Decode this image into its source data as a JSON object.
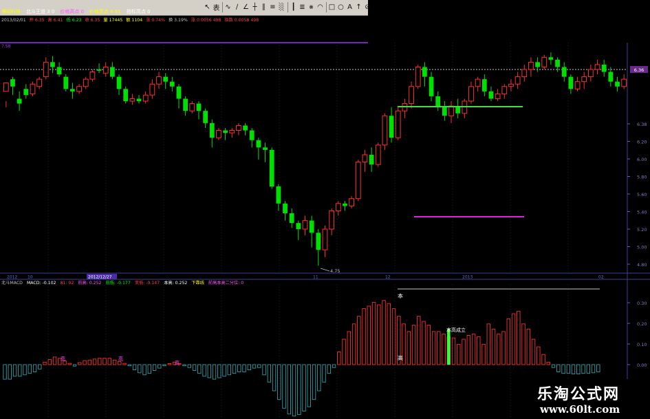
{
  "toolbar": {
    "items": [
      {
        "icon": "arrow-cursor-icon",
        "glyph": "↖"
      },
      {
        "icon": "text-tool-icon",
        "glyph": "表"
      },
      {
        "icon": "curve-tool-icon",
        "glyph": "∿"
      },
      {
        "icon": "ray-tool-icon",
        "glyph": "∕"
      },
      {
        "icon": "angle-tool-icon",
        "glyph": "∠"
      },
      {
        "icon": "cross-line-tool-icon",
        "glyph": "┼"
      },
      {
        "icon": "parallel-tool-icon",
        "glyph": "∥"
      },
      {
        "icon": "channel-tool-icon",
        "glyph": "≡"
      },
      {
        "icon": "grid-tool-icon",
        "glyph": "░"
      },
      {
        "icon": "bars-tool-icon",
        "glyph": "┃"
      },
      {
        "icon": "fibonacci-tool-icon",
        "glyph": "≣"
      },
      {
        "icon": "fan-tool-icon",
        "glyph": "⨳"
      },
      {
        "icon": "arc-tool-icon",
        "glyph": "◠"
      },
      {
        "icon": "rectangle-tool-icon",
        "glyph": "□"
      },
      {
        "icon": "circle-tool-icon",
        "glyph": "○"
      },
      {
        "icon": "label-tool-icon",
        "glyph": "A"
      },
      {
        "icon": "up-arrow-tool-icon",
        "glyph": "↑"
      },
      {
        "icon": "eraser-tool-icon",
        "glyph": "⊘"
      }
    ]
  },
  "header": {
    "line1": [
      {
        "text": "博闻科技",
        "color": "#ffff00"
      },
      {
        "text": "北斗王道 3 0",
        "color": "#ffffff"
      },
      {
        "text": "价格高点 0",
        "color": "#ff55ff"
      },
      {
        "text": "价格高点 6.61",
        "color": "#ffff00"
      },
      {
        "text": "指标高点 0",
        "color": "#ffffff"
      }
    ],
    "line2": [
      {
        "text": "2013/02/01",
        "color": "#c0c0c0"
      },
      {
        "text": "开 6.35",
        "color": "#ff4040"
      },
      {
        "text": "高 6.41",
        "color": "#ff4040"
      },
      {
        "text": "低 6.23",
        "color": "#00ff00"
      },
      {
        "text": "收 6.35",
        "color": "#ff4040"
      },
      {
        "text": "量 17445",
        "color": "#ffff00"
      },
      {
        "text": "额 1104",
        "color": "#ffff00"
      },
      {
        "text": "涨 0.74%",
        "color": "#ff4040"
      },
      {
        "text": "换 3.19%",
        "color": "#c0c0c0"
      },
      {
        "text": "涨 0.0056 498",
        "color": "#ff4040"
      },
      {
        "text": "指数 0.0058 498",
        "color": "#ff4040"
      }
    ],
    "ylabel_top": "7.58"
  },
  "price_axis": {
    "ticks": [
      "6.38",
      "6.20",
      "6.00",
      "5.80",
      "5.60",
      "5.40",
      "5.20",
      "5.00",
      "4.80"
    ],
    "current_badge": "6.36",
    "current_value": 6.36
  },
  "date_axis": {
    "labels": [
      "2012",
      "10",
      "2012/12/27",
      "11",
      "12",
      "2013",
      "02"
    ],
    "highlight": "2012/12/27"
  },
  "macd_header": [
    {
      "text": "北斗MACD",
      "color": "#c0c0c0"
    },
    {
      "text": "MACD: -0.102",
      "color": "#ffffff"
    },
    {
      "text": "81: 92",
      "color": "#ff4040"
    },
    {
      "text": "前高: 0.252",
      "color": "#ff55ff"
    },
    {
      "text": "前低: -0.177",
      "color": "#00ff00"
    },
    {
      "text": "变低: -0.147",
      "color": "#ff4040"
    },
    {
      "text": "本高: 0.252",
      "color": "#ffffff"
    },
    {
      "text": "下靠线",
      "color": "#ffff00"
    },
    {
      "text": "前高本高二分位: 0",
      "color": "#ff55ff"
    }
  ],
  "macd_axis": {
    "ticks": [
      "0.30",
      "0.20",
      "0.10",
      "0.00"
    ]
  },
  "annotations": {
    "low_price": "4.75",
    "ben": "本",
    "gao": "高",
    "bengao_chengli": "本高成立"
  },
  "chart_data": [
    {
      "type": "candlestick",
      "title": "博闻科技",
      "ylim": [
        4.7,
        6.58
      ],
      "reference_line": 6.36,
      "candles": [
        [
          6.18,
          6.25,
          6.1,
          6.05
        ],
        [
          6.28,
          6.22,
          6.3,
          6.15
        ],
        [
          6.12,
          6.08,
          6.18,
          6.02
        ],
        [
          6.2,
          6.15,
          6.24,
          6.12
        ],
        [
          6.16,
          6.24,
          6.26,
          6.14
        ],
        [
          6.22,
          6.28,
          6.3,
          6.2
        ],
        [
          6.3,
          6.42,
          6.46,
          6.28
        ],
        [
          6.42,
          6.38,
          6.47,
          6.33
        ],
        [
          6.38,
          6.32,
          6.42,
          6.3
        ],
        [
          6.3,
          6.2,
          6.32,
          6.18
        ],
        [
          6.2,
          6.18,
          6.25,
          6.12
        ],
        [
          6.18,
          6.22,
          6.24,
          6.16
        ],
        [
          6.22,
          6.28,
          6.3,
          6.2
        ],
        [
          6.28,
          6.34,
          6.36,
          6.26
        ],
        [
          6.36,
          6.35,
          6.41,
          6.33
        ],
        [
          6.33,
          6.38,
          6.42,
          6.3
        ],
        [
          6.38,
          6.3,
          6.42,
          6.28
        ],
        [
          6.3,
          6.2,
          6.32,
          6.15
        ],
        [
          6.2,
          6.1,
          6.22,
          6.08
        ],
        [
          6.1,
          6.12,
          6.16,
          6.07
        ],
        [
          6.12,
          6.1,
          6.15,
          6.08
        ],
        [
          6.1,
          6.15,
          6.18,
          6.08
        ],
        [
          6.15,
          6.24,
          6.28,
          6.12
        ],
        [
          6.24,
          6.3,
          6.34,
          6.2
        ],
        [
          6.3,
          6.26,
          6.33,
          6.2
        ],
        [
          6.26,
          6.22,
          6.3,
          6.18
        ],
        [
          6.22,
          6.12,
          6.24,
          6.04
        ],
        [
          6.12,
          6.02,
          6.14,
          5.98
        ],
        [
          6.02,
          6.08,
          6.1,
          6.0
        ],
        [
          6.08,
          6.02,
          6.1,
          5.95
        ],
        [
          6.02,
          5.92,
          6.04,
          5.88
        ],
        [
          5.92,
          5.8,
          5.95,
          5.72
        ],
        [
          5.8,
          5.86,
          5.88,
          5.78
        ],
        [
          5.86,
          5.84,
          5.88,
          5.78
        ],
        [
          5.84,
          5.86,
          5.88,
          5.8
        ],
        [
          5.86,
          5.9,
          5.92,
          5.82
        ],
        [
          5.9,
          5.86,
          5.92,
          5.82
        ],
        [
          5.86,
          5.78,
          5.88,
          5.72
        ],
        [
          5.78,
          5.72,
          5.8,
          5.62
        ],
        [
          5.72,
          5.7,
          5.76,
          5.6
        ],
        [
          5.7,
          5.4,
          5.72,
          5.38
        ],
        [
          5.4,
          5.26,
          5.42,
          5.2
        ],
        [
          5.26,
          5.18,
          5.28,
          5.12
        ],
        [
          5.18,
          5.1,
          5.22,
          5.06
        ],
        [
          5.1,
          5.05,
          5.12,
          4.96
        ],
        [
          5.05,
          5.12,
          5.16,
          5.0
        ],
        [
          5.12,
          5.02,
          5.16,
          4.9
        ],
        [
          5.02,
          4.88,
          5.05,
          4.75
        ],
        [
          4.88,
          5.05,
          5.08,
          4.82
        ],
        [
          5.05,
          5.2,
          5.22,
          5.0
        ],
        [
          5.2,
          5.26,
          5.28,
          5.16
        ],
        [
          5.26,
          5.24,
          5.28,
          5.2
        ],
        [
          5.24,
          5.3,
          5.32,
          5.22
        ],
        [
          5.3,
          5.6,
          5.62,
          5.28
        ],
        [
          5.6,
          5.66,
          5.7,
          5.52
        ],
        [
          5.66,
          5.58,
          5.72,
          5.52
        ],
        [
          5.58,
          5.74,
          5.76,
          5.56
        ],
        [
          5.74,
          5.98,
          6.0,
          5.7
        ],
        [
          5.98,
          5.8,
          6.05,
          5.76
        ],
        [
          5.8,
          6.02,
          6.06,
          5.78
        ],
        [
          6.02,
          6.08,
          6.12,
          5.96
        ],
        [
          6.08,
          6.22,
          6.26,
          6.04
        ],
        [
          6.22,
          6.38,
          6.4,
          6.2
        ],
        [
          6.38,
          6.3,
          6.42,
          6.22
        ],
        [
          6.3,
          6.14,
          6.34,
          6.1
        ],
        [
          6.14,
          6.06,
          6.18,
          6.02
        ],
        [
          6.06,
          5.98,
          6.1,
          5.94
        ],
        [
          5.98,
          6.06,
          6.1,
          5.92
        ],
        [
          6.06,
          6.0,
          6.12,
          5.96
        ],
        [
          6.0,
          6.1,
          6.12,
          5.96
        ],
        [
          6.1,
          6.22,
          6.26,
          6.08
        ],
        [
          6.22,
          6.28,
          6.3,
          6.18
        ],
        [
          6.28,
          6.18,
          6.32,
          6.14
        ],
        [
          6.18,
          6.12,
          6.22,
          6.1
        ],
        [
          6.12,
          6.16,
          6.2,
          6.1
        ],
        [
          6.16,
          6.22,
          6.24,
          6.12
        ],
        [
          6.22,
          6.24,
          6.28,
          6.18
        ],
        [
          6.24,
          6.3,
          6.34,
          6.2
        ],
        [
          6.3,
          6.36,
          6.4,
          6.26
        ],
        [
          6.36,
          6.42,
          6.46,
          6.3
        ],
        [
          6.42,
          6.38,
          6.46,
          6.34
        ],
        [
          6.38,
          6.46,
          6.48,
          6.36
        ],
        [
          6.46,
          6.44,
          6.5,
          6.4
        ],
        [
          6.44,
          6.38,
          6.46,
          6.34
        ],
        [
          6.38,
          6.3,
          6.42,
          6.26
        ],
        [
          6.3,
          6.2,
          6.32,
          6.16
        ],
        [
          6.2,
          6.26,
          6.3,
          6.18
        ],
        [
          6.26,
          6.3,
          6.34,
          6.2
        ],
        [
          6.3,
          6.36,
          6.4,
          6.26
        ],
        [
          6.36,
          6.4,
          6.44,
          6.32
        ],
        [
          6.4,
          6.34,
          6.44,
          6.3
        ],
        [
          6.34,
          6.26,
          6.38,
          6.22
        ],
        [
          6.26,
          6.22,
          6.3,
          6.18
        ],
        [
          6.22,
          6.28,
          6.32,
          6.2
        ]
      ]
    },
    {
      "type": "bar",
      "title": "北斗MACD",
      "ylim": [
        -0.18,
        0.3
      ],
      "values": [
        -0.05,
        -0.05,
        -0.04,
        -0.04,
        -0.035,
        -0.03,
        -0.025,
        -0.015,
        0.01,
        0.02,
        0.03,
        0.025,
        0.015,
        0.005,
        -0.005,
        0.008,
        0.016,
        0.018,
        0.022,
        0.025,
        0.025,
        0.025,
        0.018,
        0.012,
        0.005,
        -0.004,
        -0.018,
        -0.028,
        -0.035,
        -0.03,
        -0.02,
        -0.012,
        -0.004,
        0.004,
        0.01,
        0.004,
        -0.004,
        -0.01,
        -0.02,
        -0.03,
        -0.04,
        -0.045,
        -0.05,
        -0.045,
        -0.04,
        -0.035,
        -0.03,
        -0.025,
        -0.025,
        -0.018,
        -0.012,
        -0.01,
        -0.035,
        -0.06,
        -0.09,
        -0.12,
        -0.15,
        -0.17,
        -0.177,
        -0.172,
        -0.16,
        -0.145,
        -0.12,
        -0.09,
        -0.06,
        -0.03,
        -0.01,
        0.05,
        0.1,
        0.13,
        0.16,
        0.19,
        0.22,
        0.23,
        0.245,
        0.235,
        0.252,
        0.24,
        0.22,
        0.19,
        0.16,
        0.13,
        0.155,
        0.19,
        0.17,
        0.155,
        0.13,
        0.13,
        0.12,
        0.11,
        0.105,
        0.08,
        0.1,
        0.115,
        0.12,
        0.11,
        0.08,
        0.16,
        0.14,
        0.12,
        0.13,
        0.18,
        0.2,
        0.21,
        0.16,
        0.14,
        0.1,
        0.07,
        0.04,
        0.01,
        -0.01,
        -0.025,
        -0.03,
        -0.03,
        -0.032,
        -0.032,
        -0.03,
        -0.03,
        -0.028,
        -0.025
      ]
    }
  ]
}
